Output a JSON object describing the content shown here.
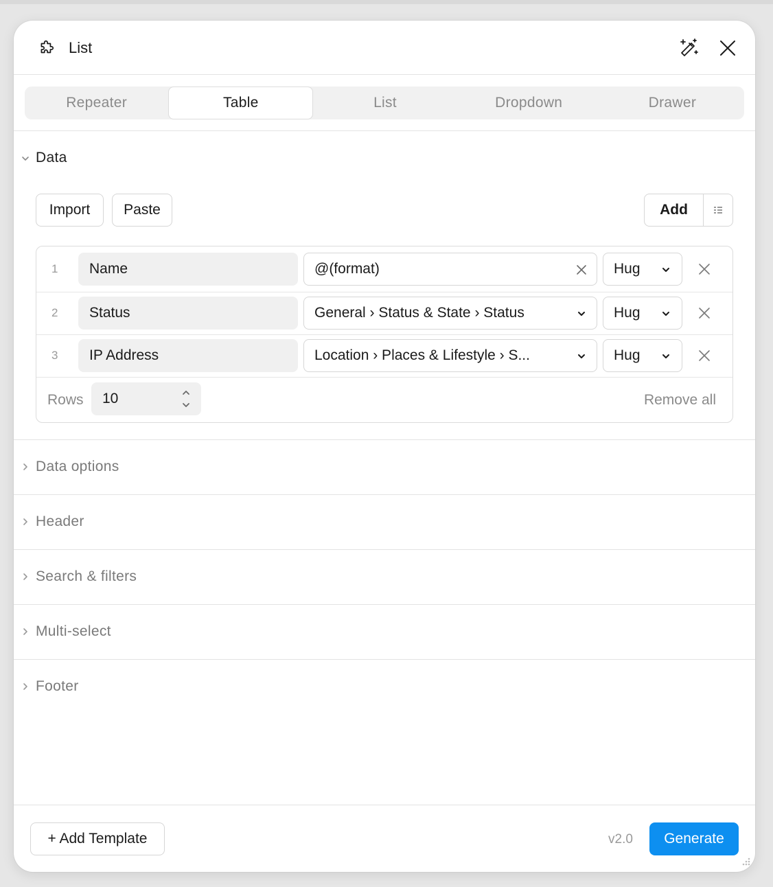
{
  "window": {
    "title": "List",
    "plugin_icon": "plugin-icon",
    "wand_icon": "magic-wand-icon",
    "close_icon": "close-icon"
  },
  "tabs": [
    {
      "label": "Repeater",
      "active": false
    },
    {
      "label": "Table",
      "active": true
    },
    {
      "label": "List",
      "active": false
    },
    {
      "label": "Dropdown",
      "active": false
    },
    {
      "label": "Drawer",
      "active": false
    }
  ],
  "data_section": {
    "label": "Data",
    "expanded": true,
    "import_label": "Import",
    "paste_label": "Paste",
    "add_label": "Add",
    "rows": [
      {
        "num": "1",
        "name": "Name",
        "value": "@(format)",
        "value_icon": "clear-icon",
        "size": "Hug"
      },
      {
        "num": "2",
        "name": "Status",
        "value": "General › Status & State › Status",
        "value_icon": "chevron-down-icon",
        "size": "Hug"
      },
      {
        "num": "3",
        "name": "IP Address",
        "value": "Location › Places & Lifestyle › S...",
        "value_icon": "chevron-down-icon",
        "size": "Hug"
      }
    ],
    "rows_label": "Rows",
    "rows_value": "10",
    "remove_all_label": "Remove all"
  },
  "collapsed_sections": [
    {
      "label": "Data options"
    },
    {
      "label": "Header"
    },
    {
      "label": "Search & filters"
    },
    {
      "label": "Multi-select"
    },
    {
      "label": "Footer"
    }
  ],
  "footer": {
    "add_template_label": "+ Add Template",
    "version": "v2.0",
    "generate_label": "Generate"
  },
  "colors": {
    "accent": "#0d8ff0",
    "panel": "#ffffff",
    "background": "#e6e6e6"
  }
}
